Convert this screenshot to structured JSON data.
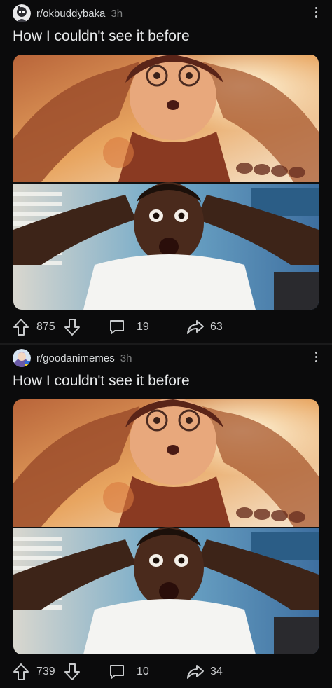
{
  "posts": [
    {
      "subreddit": "r/okbuddybaka",
      "time": "3h",
      "title": "How I couldn't see it before",
      "votes": "875",
      "comments": "19",
      "shares": "63"
    },
    {
      "subreddit": "r/goodanimemes",
      "time": "3h",
      "title": "How I couldn't see it before",
      "votes": "739",
      "comments": "10",
      "shares": "34"
    }
  ],
  "icons": {
    "upvote": "arrow-up-icon",
    "downvote": "arrow-down-icon",
    "comment": "speech-bubble-icon",
    "share": "share-arrow-icon",
    "more": "vertical-dots-icon"
  },
  "colors": {
    "background": "#0b0b0c",
    "text": "#d7dadc",
    "muted": "#818384"
  }
}
